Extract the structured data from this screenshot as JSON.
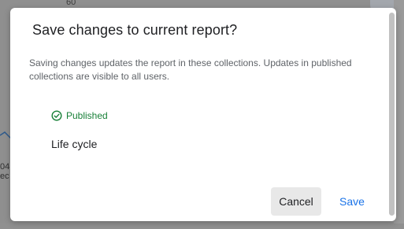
{
  "background": {
    "axis_tick_label": "60",
    "fragment_text": "04\nec"
  },
  "dialog": {
    "title": "Save changes to current report?",
    "message": "Saving changes updates the report in these collections. Updates in published collections are visible to all users.",
    "collection": {
      "status_icon": "check-circle-icon",
      "status_label": "Published",
      "status_color": "#188038",
      "name": "Life cycle"
    },
    "buttons": {
      "cancel_label": "Cancel",
      "save_label": "Save"
    },
    "colors": {
      "accent": "#1a73e8",
      "title_text": "#202124",
      "body_text": "#5f6368"
    }
  }
}
